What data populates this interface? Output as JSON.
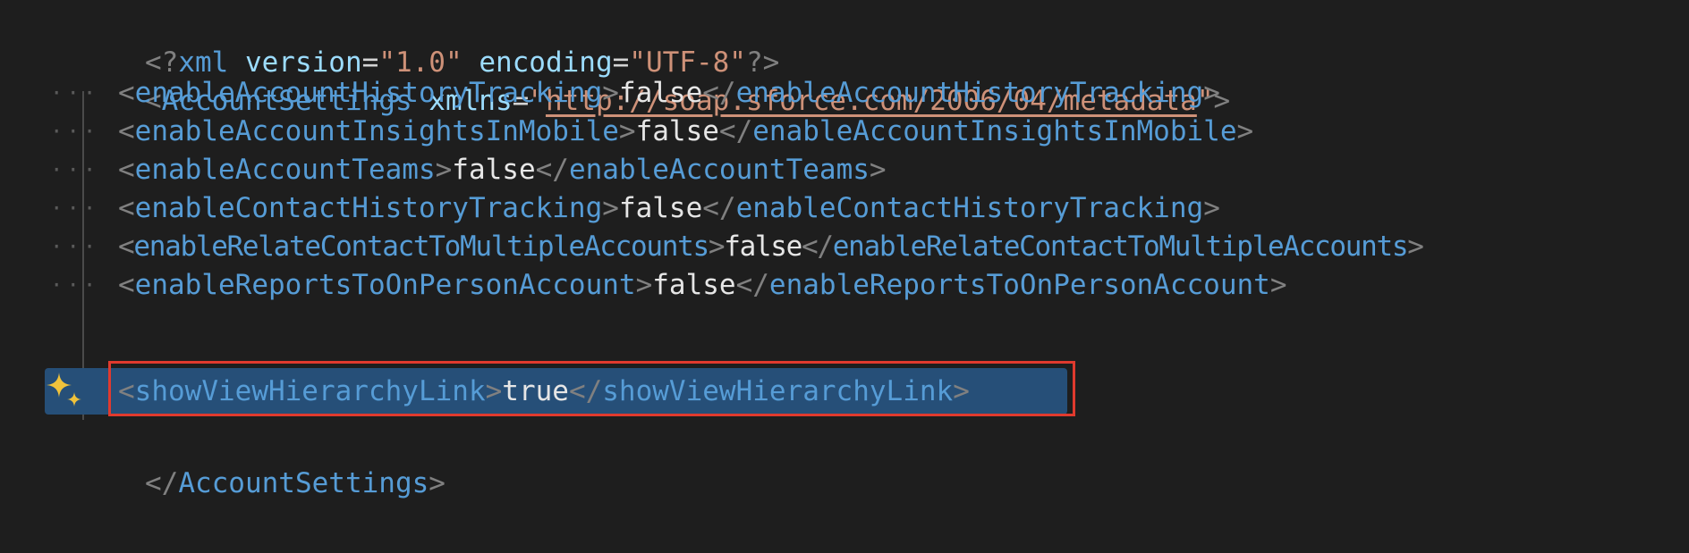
{
  "editor": {
    "declaration": {
      "open": "<?",
      "name": "xml",
      "attr1_name": "version",
      "attr1_eq": "=",
      "attr1_value": "\"1.0\"",
      "attr2_name": "encoding",
      "attr2_eq": "=",
      "attr2_value": "\"UTF-8\"",
      "close": "?>"
    },
    "root_open": {
      "lt": "<",
      "name": "AccountSettings",
      "attr_name": "xmlns",
      "eq": "=",
      "quote": "\"",
      "url": "http://soap.sforce.com/2006/04/metadata",
      "gt": ">"
    },
    "indent_dots": "···",
    "settings": [
      {
        "tag": "enableAccountHistoryTracking",
        "value": "false"
      },
      {
        "tag": "enableAccountInsightsInMobile",
        "value": "false"
      },
      {
        "tag": "enableAccountTeams",
        "value": "false"
      },
      {
        "tag": "enableContactHistoryTracking",
        "value": "false"
      },
      {
        "tag": "enableRelateContactToMultipleAccounts",
        "value": "false"
      },
      {
        "tag": "enableReportsToOnPersonAccount",
        "value": "false"
      },
      {
        "tag": "showViewHierarchyLink",
        "value": "true"
      }
    ],
    "punct": {
      "lt": "<",
      "gt": ">",
      "lt_slash": "</"
    },
    "root_close": {
      "open": "</",
      "name": "AccountSettings",
      "close": ">"
    },
    "sparkle_icon": "sparkle-icon",
    "colors": {
      "background": "#1e1e1e",
      "selection": "#264f78",
      "highlight_box": "#e03a2e",
      "sparkle": "#f0c23b"
    }
  }
}
